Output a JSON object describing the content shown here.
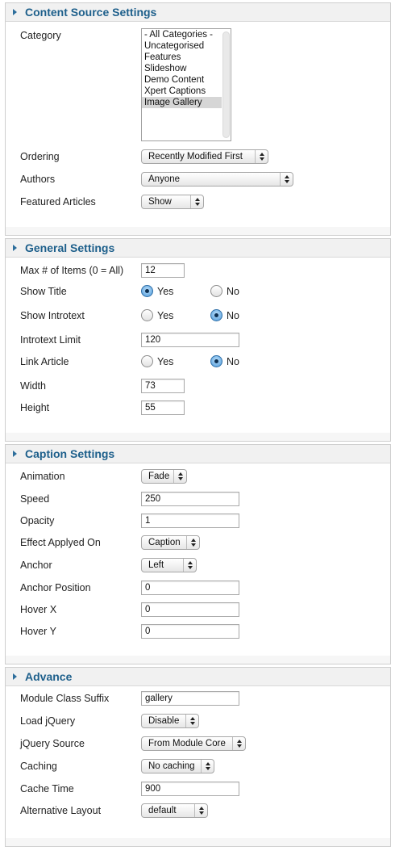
{
  "content_source": {
    "title": "Content Source Settings",
    "category_label": "Category",
    "category_options": [
      "- All Categories -",
      "Uncategorised",
      "Features",
      "Slideshow",
      "Demo Content",
      "Xpert Captions",
      "Image Gallery"
    ],
    "category_selected": "Image Gallery",
    "ordering_label": "Ordering",
    "ordering_value": "Recently Modified First",
    "authors_label": "Authors",
    "authors_value": "Anyone",
    "featured_label": "Featured Articles",
    "featured_value": "Show"
  },
  "general": {
    "title": "General Settings",
    "max_items_label": "Max # of Items (0 = All)",
    "max_items_value": "12",
    "show_title_label": "Show Title",
    "show_title_value": "Yes",
    "show_introtext_label": "Show Introtext",
    "show_introtext_value": "No",
    "introtext_limit_label": "Introtext Limit",
    "introtext_limit_value": "120",
    "link_article_label": "Link Article",
    "link_article_value": "No",
    "width_label": "Width",
    "width_value": "73",
    "height_label": "Height",
    "height_value": "55",
    "yes_label": "Yes",
    "no_label": "No"
  },
  "caption": {
    "title": "Caption Settings",
    "animation_label": "Animation",
    "animation_value": "Fade",
    "speed_label": "Speed",
    "speed_value": "250",
    "opacity_label": "Opacity",
    "opacity_value": "1",
    "effect_label": "Effect Applyed On",
    "effect_value": "Caption",
    "anchor_label": "Anchor",
    "anchor_value": "Left",
    "anchor_position_label": "Anchor Position",
    "anchor_position_value": "0",
    "hover_x_label": "Hover X",
    "hover_x_value": "0",
    "hover_y_label": "Hover Y",
    "hover_y_value": "0"
  },
  "advance": {
    "title": "Advance",
    "module_class_label": "Module Class Suffix",
    "module_class_value": "gallery",
    "load_jquery_label": "Load jQuery",
    "load_jquery_value": "Disable",
    "jquery_source_label": "jQuery Source",
    "jquery_source_value": "From Module Core",
    "caching_label": "Caching",
    "caching_value": "No caching",
    "cache_time_label": "Cache Time",
    "cache_time_value": "900",
    "alt_layout_label": "Alternative Layout",
    "alt_layout_value": "default"
  }
}
